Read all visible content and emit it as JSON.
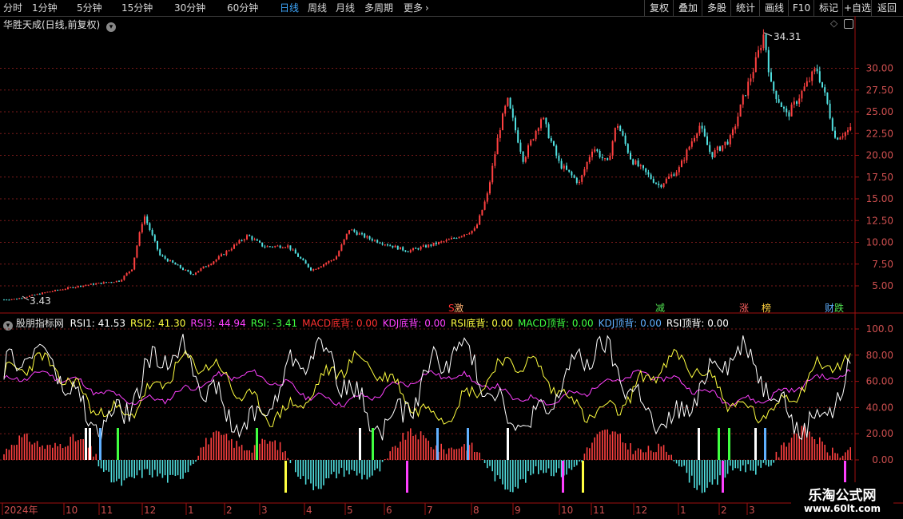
{
  "toolbar": {
    "periods": [
      {
        "label": "分时",
        "active": false
      },
      {
        "label": "1分钟",
        "active": false
      },
      {
        "label": "5分钟",
        "active": false
      },
      {
        "label": "15分钟",
        "active": false
      },
      {
        "label": "30分钟",
        "active": false
      },
      {
        "label": "60分钟",
        "active": false
      },
      {
        "label": "日线",
        "active": true
      },
      {
        "label": "周线",
        "active": false
      },
      {
        "label": "月线",
        "active": false
      },
      {
        "label": "多周期",
        "active": false
      },
      {
        "label": "更多",
        "active": false
      }
    ],
    "right_buttons": [
      "复权",
      "叠加",
      "多股",
      "统计",
      "画线",
      "F10",
      "标记",
      "+自选",
      "返回"
    ]
  },
  "main_chart": {
    "title": "华胜天成(日线,前复权)",
    "high_label": "34.31",
    "low_label": "3.43",
    "y_ticks": [
      "5.00",
      "7.50",
      "10.00",
      "12.50",
      "15.00",
      "17.50",
      "20.00",
      "22.50",
      "25.00",
      "27.50",
      "30.00"
    ],
    "events": [
      {
        "text": "S",
        "color": "#ff3030"
      },
      {
        "text": "激",
        "color": "#ffb070"
      },
      {
        "text": "减",
        "color": "#50e050"
      },
      {
        "text": "涨",
        "color": "#ff6060"
      },
      {
        "text": "榜",
        "color": "#ffd040"
      },
      {
        "text": "财",
        "color": "#60b0ff"
      },
      {
        "text": "跌",
        "color": "#50e050"
      }
    ]
  },
  "indicator": {
    "name": "股朋指标网",
    "legend": [
      {
        "label": "RSI1:",
        "value": "41.53",
        "color": "#ffffff"
      },
      {
        "label": "RSI2:",
        "value": "41.30",
        "color": "#ffff40"
      },
      {
        "label": "RSI3:",
        "value": "44.94",
        "color": "#ff40ff"
      },
      {
        "label": "RSI:",
        "value": "-3.41",
        "color": "#40ff40"
      },
      {
        "label": "MACD底背:",
        "value": "0.00",
        "color": "#ff3030"
      },
      {
        "label": "KDJ底背:",
        "value": "0.00",
        "color": "#ff40ff"
      },
      {
        "label": "RSI底背:",
        "value": "0.00",
        "color": "#ffff40"
      },
      {
        "label": "MACD顶背:",
        "value": "0.00",
        "color": "#40ff40"
      },
      {
        "label": "KDJ顶背:",
        "value": "0.00",
        "color": "#60b0ff"
      },
      {
        "label": "RSI顶背:",
        "value": "0.00",
        "color": "#ffffff"
      }
    ],
    "y_ticks": [
      "0.00",
      "20.00",
      "40.00",
      "60.00",
      "80.00",
      "100.0"
    ]
  },
  "time_axis": {
    "labels": [
      "2024年",
      "10",
      "11",
      "12",
      "1",
      "2",
      "3",
      "4",
      "5",
      "6",
      "7",
      "8",
      "9",
      "10",
      "11",
      "12",
      "1",
      "2",
      "3"
    ]
  },
  "watermark": {
    "line1": "乐淘公式网",
    "line2": "www.60lt.com"
  },
  "colors": {
    "up": "#ff4040",
    "down": "#50e0e0",
    "grid": "#7a1a1a",
    "axis": "#a01010",
    "active_tab": "#3fa9ff"
  },
  "icons": {
    "title_dropdown": "chevron-down-icon",
    "indicator_dropdown": "chevron-down-icon",
    "more_arrow": "chevron-right-icon",
    "diamond": "diamond-icon",
    "panel_toggle": "panel-toggle-icon"
  }
}
